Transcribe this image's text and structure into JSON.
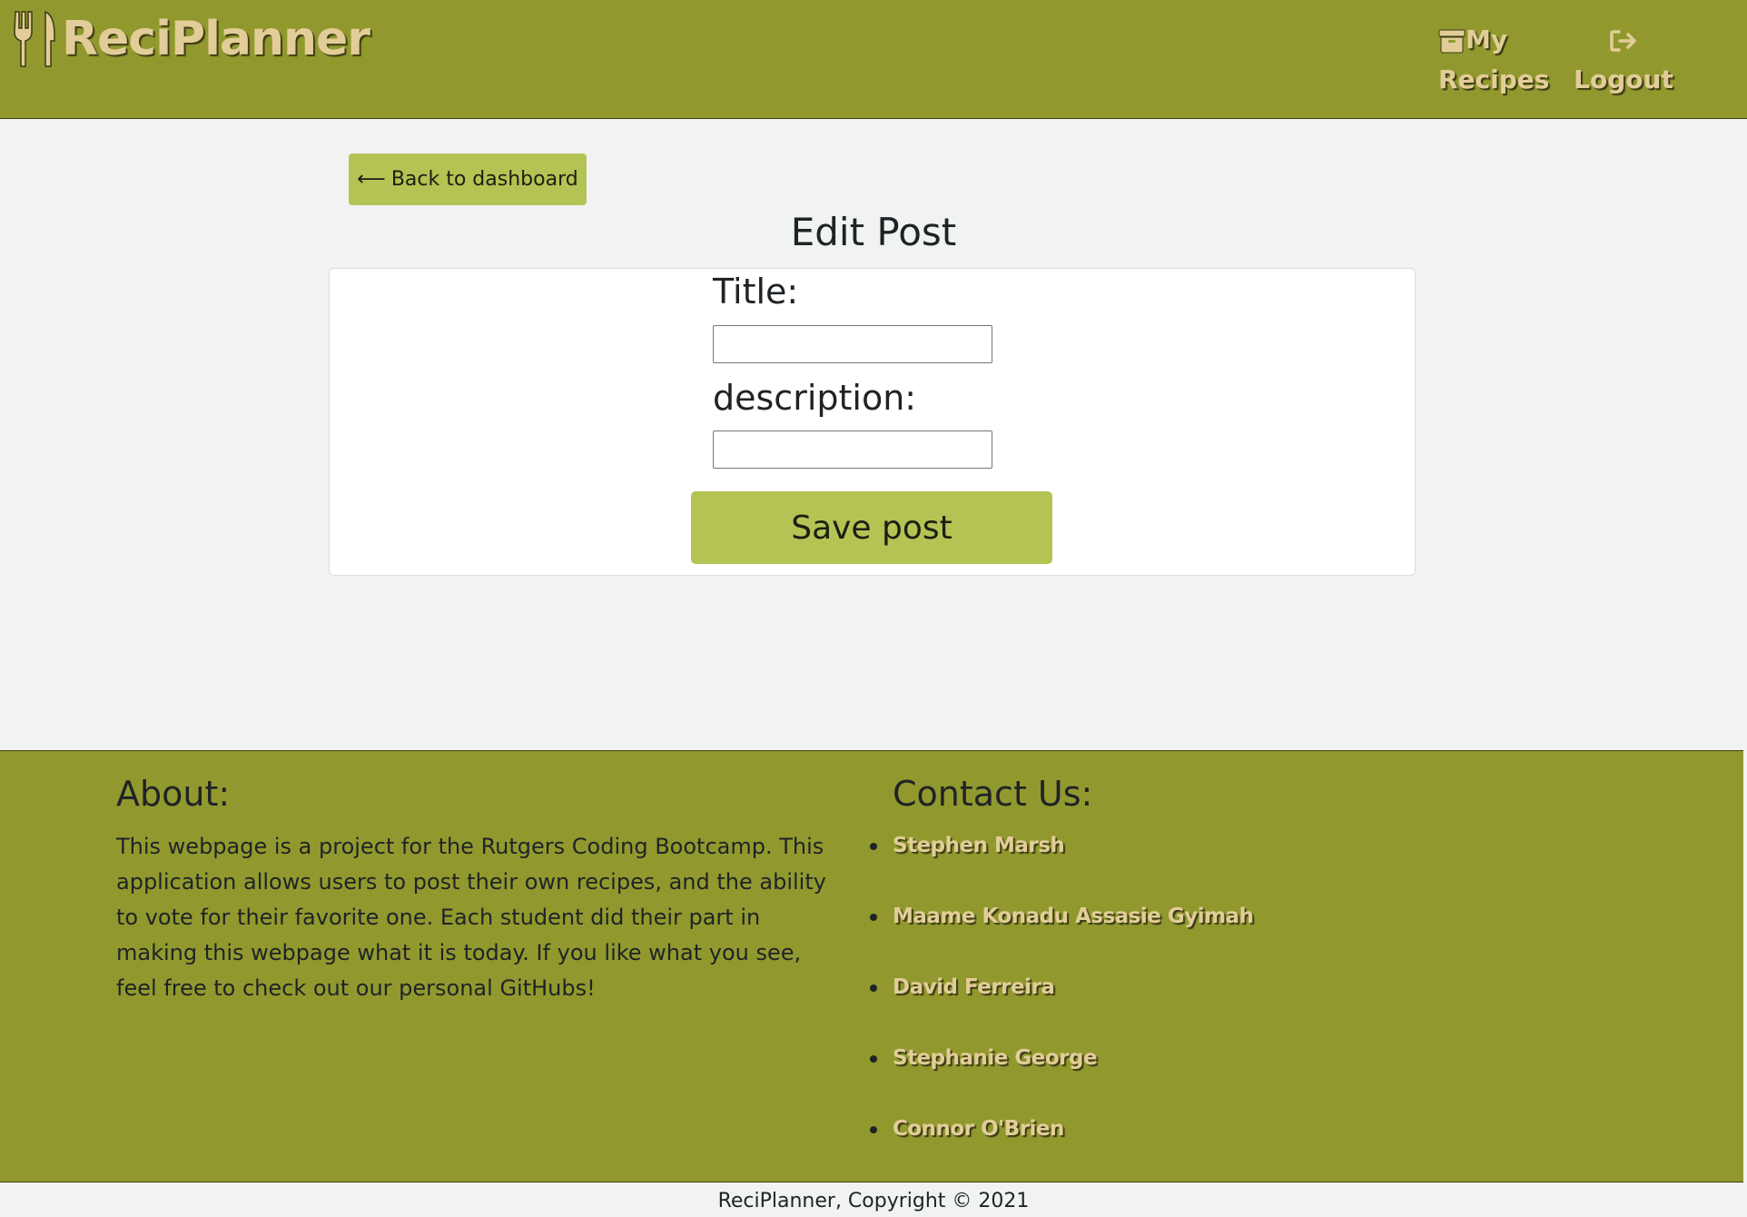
{
  "header": {
    "brand_name": "ReciPlanner",
    "nav": {
      "my_recipes_line1": "My",
      "my_recipes_line2": "Recipes",
      "logout_label": "Logout"
    }
  },
  "main": {
    "back_button_label": "Back to dashboard",
    "back_arrow": "⟵",
    "page_title": "Edit Post",
    "form": {
      "title_label": "Title:",
      "title_value": "",
      "description_label": "description:",
      "description_value": "",
      "save_button_label": "Save post"
    }
  },
  "footer": {
    "about_heading": "About:",
    "about_text": "This webpage is a project for the Rutgers Coding Bootcamp. This application allows users to post their own recipes, and the ability to vote for their favorite one. Each student did their part in making this webpage what it is today. If you like what you see, feel free to check out our personal GitHubs!",
    "contact_heading": "Contact Us:",
    "contacts": [
      {
        "name": "Stephen Marsh"
      },
      {
        "name": "Maame Konadu Assasie Gyimah"
      },
      {
        "name": "David Ferreira"
      },
      {
        "name": "Stephanie George"
      },
      {
        "name": "Connor O'Brien"
      }
    ],
    "copyright": "ReciPlanner, Copyright © 2021"
  },
  "icons": {
    "brand": "fork-knife-icon",
    "my_recipes": "archive-box-icon",
    "logout": "sign-out-icon"
  },
  "colors": {
    "header_bg": "#91992e",
    "accent_button": "#b5c354",
    "brand_text": "#e2cd98",
    "page_bg": "#f1f3f2"
  }
}
